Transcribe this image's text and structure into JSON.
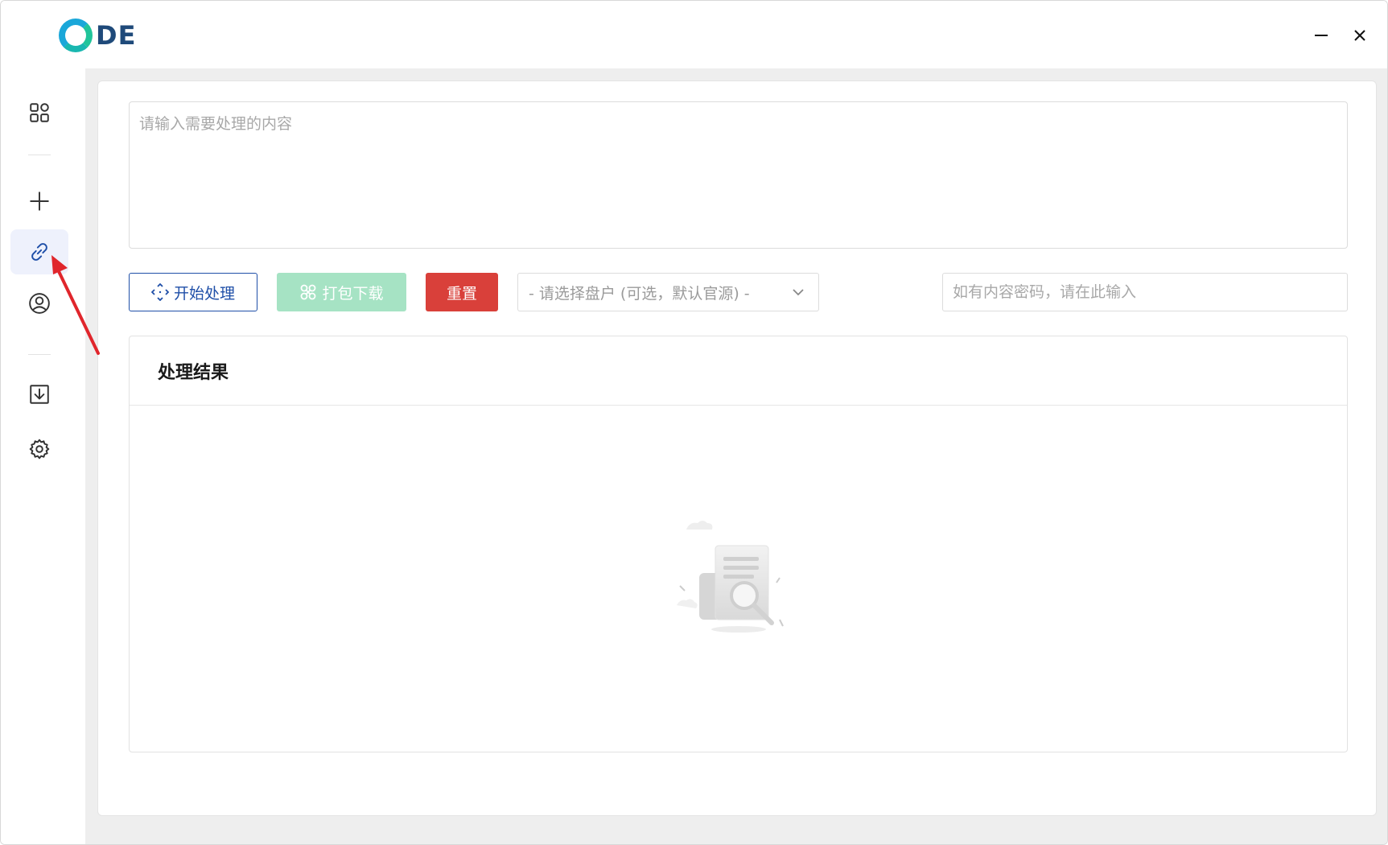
{
  "app": {
    "logo_text": "DE"
  },
  "window_controls": {
    "minimize_icon": "minimize-icon",
    "close_icon": "close-icon"
  },
  "sidebar": {
    "items": [
      {
        "icon": "grid-icon",
        "active": false
      },
      {
        "icon": "plus-icon",
        "active": false
      },
      {
        "icon": "link-icon",
        "active": true
      },
      {
        "icon": "user-circle-icon",
        "active": false
      },
      {
        "icon": "download-box-icon",
        "active": false
      },
      {
        "icon": "gear-icon",
        "active": false
      }
    ]
  },
  "main": {
    "content_input": {
      "value": "",
      "placeholder": "请输入需要处理的内容"
    },
    "buttons": {
      "start_label": "开始处理",
      "pack_label": "打包下载",
      "reset_label": "重置"
    },
    "disk_select": {
      "selected": "- 请选择盘户 (可选，默认官源) -"
    },
    "password_input": {
      "value": "",
      "placeholder": "如有内容密码，请在此输入"
    },
    "result": {
      "title": "处理结果"
    }
  },
  "colors": {
    "primary": "#1f4fa8",
    "pack_button": "#a6e3c4",
    "reset_button": "#d9403a",
    "annotation_arrow": "#e0262c",
    "active_sidebar_bg": "#eef1fc"
  }
}
